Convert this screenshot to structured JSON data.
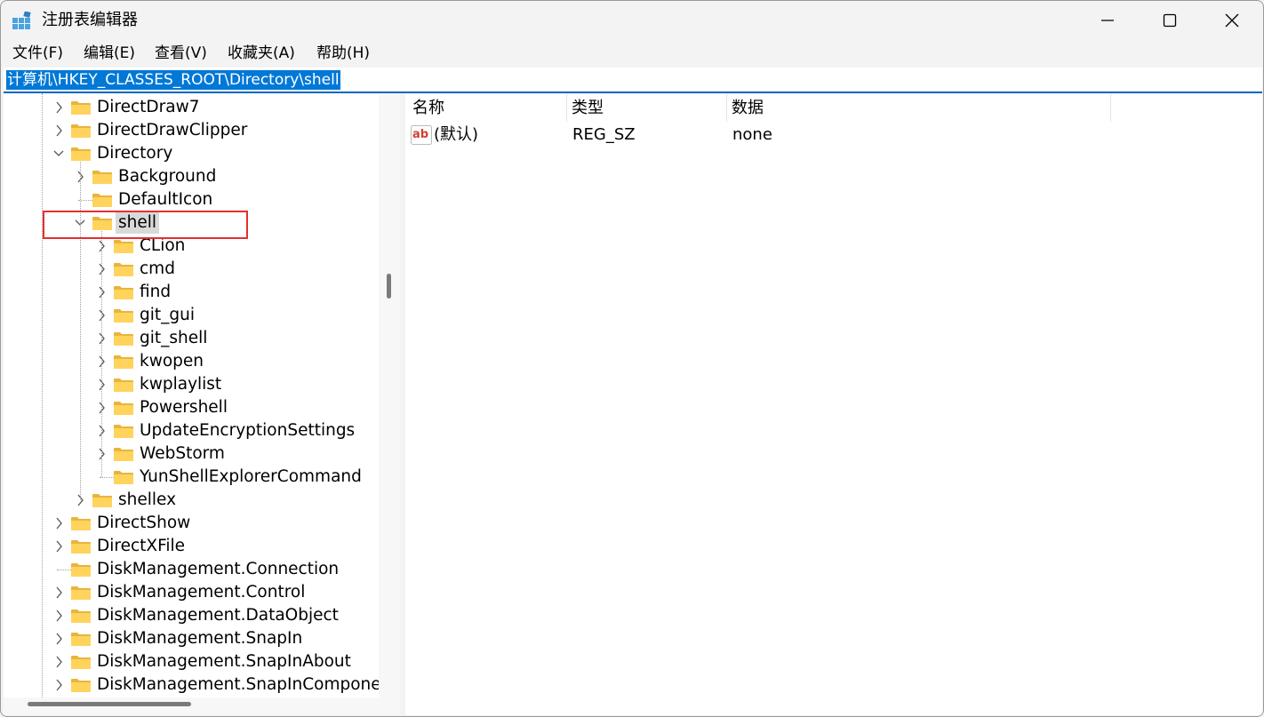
{
  "window": {
    "title": "注册表编辑器",
    "icons": {
      "app": "registry-editor-icon",
      "minimize": "minimize-icon",
      "maximize": "maximize-icon",
      "close": "close-icon"
    }
  },
  "menu": [
    "文件(F)",
    "编辑(E)",
    "查看(V)",
    "收藏夹(A)",
    "帮助(H)"
  ],
  "address": {
    "path": "计算机\\HKEY_CLASSES_ROOT\\Directory\\shell"
  },
  "tree": {
    "items": [
      {
        "label": "DirectDraw7",
        "level": 1,
        "expander": "collapsed"
      },
      {
        "label": "DirectDrawClipper",
        "level": 1,
        "expander": "collapsed"
      },
      {
        "label": "Directory",
        "level": 1,
        "expander": "expanded"
      },
      {
        "label": "Background",
        "level": 2,
        "expander": "collapsed"
      },
      {
        "label": "DefaultIcon",
        "level": 2,
        "expander": "none"
      },
      {
        "label": "shell",
        "level": 2,
        "expander": "expanded",
        "selected": true
      },
      {
        "label": "CLion",
        "level": 3,
        "expander": "collapsed"
      },
      {
        "label": "cmd",
        "level": 3,
        "expander": "collapsed"
      },
      {
        "label": "find",
        "level": 3,
        "expander": "collapsed"
      },
      {
        "label": "git_gui",
        "level": 3,
        "expander": "collapsed"
      },
      {
        "label": "git_shell",
        "level": 3,
        "expander": "collapsed"
      },
      {
        "label": "kwopen",
        "level": 3,
        "expander": "collapsed"
      },
      {
        "label": "kwplaylist",
        "level": 3,
        "expander": "collapsed"
      },
      {
        "label": "Powershell",
        "level": 3,
        "expander": "collapsed"
      },
      {
        "label": "UpdateEncryptionSettings",
        "level": 3,
        "expander": "collapsed"
      },
      {
        "label": "WebStorm",
        "level": 3,
        "expander": "collapsed"
      },
      {
        "label": "YunShellExplorerCommand",
        "level": 3,
        "expander": "none"
      },
      {
        "label": "shellex",
        "level": 2,
        "expander": "collapsed"
      },
      {
        "label": "DirectShow",
        "level": 1,
        "expander": "collapsed"
      },
      {
        "label": "DirectXFile",
        "level": 1,
        "expander": "collapsed"
      },
      {
        "label": "DiskManagement.Connection",
        "level": 1,
        "expander": "none"
      },
      {
        "label": "DiskManagement.Control",
        "level": 1,
        "expander": "collapsed"
      },
      {
        "label": "DiskManagement.DataObject",
        "level": 1,
        "expander": "collapsed"
      },
      {
        "label": "DiskManagement.SnapIn",
        "level": 1,
        "expander": "collapsed"
      },
      {
        "label": "DiskManagement.SnapInAbout",
        "level": 1,
        "expander": "collapsed"
      },
      {
        "label": "DiskManagement.SnapInComponent",
        "level": 1,
        "expander": "collapsed"
      }
    ],
    "folder_icon": "folder-icon",
    "highlight_color": "#e53030"
  },
  "list": {
    "columns": [
      "名称",
      "类型",
      "数据"
    ],
    "rows": [
      {
        "name": "(默认)",
        "type": "REG_SZ",
        "data": "none",
        "icon": "string-value-icon"
      }
    ]
  },
  "colors": {
    "accent": "#0078d7",
    "selection": "#d9d9d9"
  }
}
